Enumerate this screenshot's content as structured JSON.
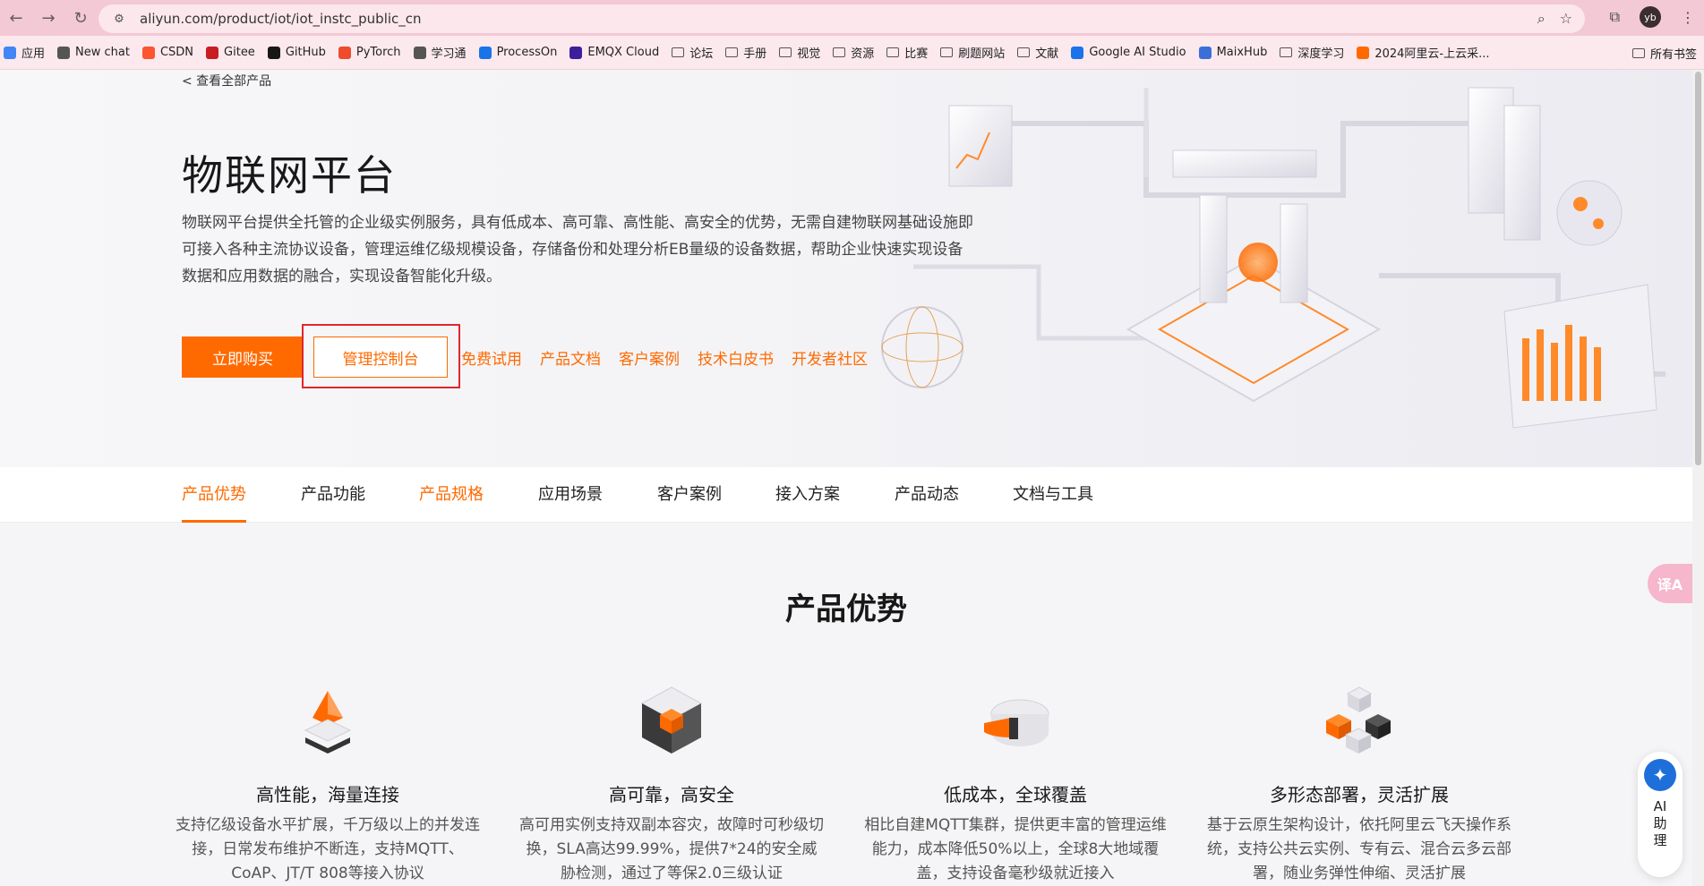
{
  "browser": {
    "url": "aliyun.com/product/iot/iot_instc_public_cn",
    "profile_initials": "yb",
    "bookmarks": [
      {
        "label": "应用",
        "icon": "apps-grid-icon",
        "color": "#4285f4"
      },
      {
        "label": "New chat",
        "icon": "chat-icon",
        "color": "#555555"
      },
      {
        "label": "CSDN",
        "icon": "csdn-icon",
        "color": "#fc5531"
      },
      {
        "label": "Gitee",
        "icon": "gitee-icon",
        "color": "#c71d23"
      },
      {
        "label": "GitHub",
        "icon": "github-icon",
        "color": "#181717"
      },
      {
        "label": "PyTorch",
        "icon": "pytorch-icon",
        "color": "#ee4c2c"
      },
      {
        "label": "学习通",
        "icon": "globe-icon",
        "color": "#555555"
      },
      {
        "label": "ProcessOn",
        "icon": "processon-icon",
        "color": "#1a73e8"
      },
      {
        "label": "EMQX Cloud",
        "icon": "emqx-icon",
        "color": "#3d1f9c"
      },
      {
        "label": "论坛",
        "icon": "folder-icon"
      },
      {
        "label": "手册",
        "icon": "folder-icon"
      },
      {
        "label": "视觉",
        "icon": "folder-icon"
      },
      {
        "label": "资源",
        "icon": "folder-icon"
      },
      {
        "label": "比赛",
        "icon": "folder-icon"
      },
      {
        "label": "刷题网站",
        "icon": "folder-icon"
      },
      {
        "label": "文献",
        "icon": "folder-icon"
      },
      {
        "label": "Google AI Studio",
        "icon": "google-ai-studio-icon",
        "color": "#1a73e8"
      },
      {
        "label": "MaixHub",
        "icon": "maixhub-icon",
        "color": "#3b6fd8"
      },
      {
        "label": "深度学习",
        "icon": "folder-icon"
      },
      {
        "label": "2024阿里云-上云采...",
        "icon": "aliyun-icon",
        "color": "#ff6a00"
      }
    ],
    "all_bookmarks_label": "所有书签"
  },
  "hero": {
    "back_link": "< 查看全部产品",
    "title": "物联网平台",
    "description": "物联网平台提供全托管的企业级实例服务，具有低成本、高可靠、高性能、高安全的优势，无需自建物联网基础设施即可接入各种主流协议设备，管理运维亿级规模设备，存储备份和处理分析EB量级的设备数据，帮助企业快速实现设备数据和应用数据的融合，实现设备智能化升级。",
    "buy_label": "立即购买",
    "console_label": "管理控制台",
    "links": [
      "免费试用",
      "产品文档",
      "客户案例",
      "技术白皮书",
      "开发者社区"
    ]
  },
  "tabs": [
    {
      "label": "产品优势",
      "state": "active"
    },
    {
      "label": "产品功能",
      "state": "normal"
    },
    {
      "label": "产品规格",
      "state": "orange"
    },
    {
      "label": "应用场景",
      "state": "normal"
    },
    {
      "label": "客户案例",
      "state": "normal"
    },
    {
      "label": "接入方案",
      "state": "normal"
    },
    {
      "label": "产品动态",
      "state": "normal"
    },
    {
      "label": "文档与工具",
      "state": "normal"
    }
  ],
  "advantages": {
    "title": "产品优势",
    "items": [
      {
        "title": "高性能，海量连接",
        "text": "支持亿级设备水平扩展，千万级以上的并发连接，日常发布维护不断连，支持MQTT、CoAP、JT/T 808等接入协议",
        "icon": "pyramid-icon"
      },
      {
        "title": "高可靠，高安全",
        "text": "高可用实例支持双副本容灾，故障时可秒级切换，SLA高达99.99%，提供7*24的安全威胁检测，通过了等保2.0三级认证",
        "icon": "cube-icon"
      },
      {
        "title": "低成本，全球覆盖",
        "text": "相比自建MQTT集群，提供更丰富的管理运维能力，成本降低50%以上，全球8大地域覆盖，支持设备毫秒级就近接入",
        "icon": "pie-icon"
      },
      {
        "title": "多形态部署，灵活扩展",
        "text": "基于云原生架构设计，依托阿里云飞天操作系统，支持公共云实例、专有云、混合云多云部署，随业务弹性伸缩、灵活扩展",
        "icon": "blocks-icon"
      }
    ]
  },
  "widgets": {
    "translate_label": "译A",
    "ai_label": "AI助理"
  },
  "colors": {
    "accent": "#ff6a00",
    "highlight": "#e0262b",
    "chrome": "#f2c9d4"
  }
}
